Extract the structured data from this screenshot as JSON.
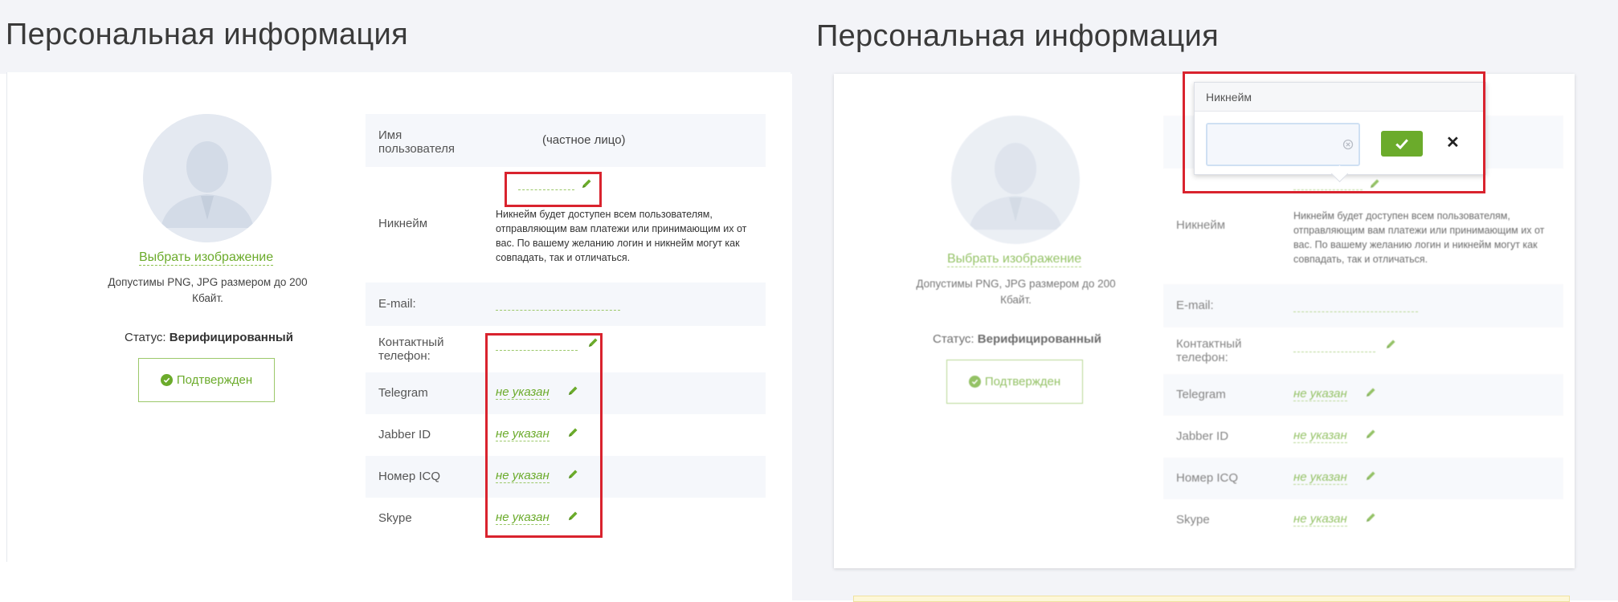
{
  "page": {
    "title": "Персональная информация"
  },
  "profile": {
    "choose_image": "Выбрать изображение",
    "image_hint": "Допустимы PNG, JPG размером до 200 Кбайт.",
    "status_label": "Статус:",
    "status_value": "Верифицированный",
    "confirmed_label": "Подтвержден"
  },
  "fields": {
    "username": {
      "label": "Имя пользователя",
      "value": "(частное лицо)"
    },
    "nickname": {
      "label": "Никнейм",
      "description": "Никнейм будет доступен всем пользователям, отправляющим вам платежи или принимающим их от вас. По вашему желанию логин и никнейм могут как совпадать, так и отличаться."
    },
    "email": {
      "label": "E-mail:"
    },
    "phone": {
      "label": "Контактный телефон:"
    },
    "telegram": {
      "label": "Telegram",
      "value": "не указан"
    },
    "jabber": {
      "label": "Jabber ID",
      "value": "не указан"
    },
    "icq": {
      "label": "Номер ICQ",
      "value": "не указан"
    },
    "skype": {
      "label": "Skype",
      "value": "не указан"
    }
  },
  "popover": {
    "title": "Никнейм",
    "input_value": "",
    "input_placeholder": "",
    "cancel_symbol": "✕"
  },
  "colors": {
    "accent": "#6bab2b",
    "highlight": "#d9232e",
    "row_shade": "#f5f7fb",
    "background": "#f3f4f8"
  }
}
